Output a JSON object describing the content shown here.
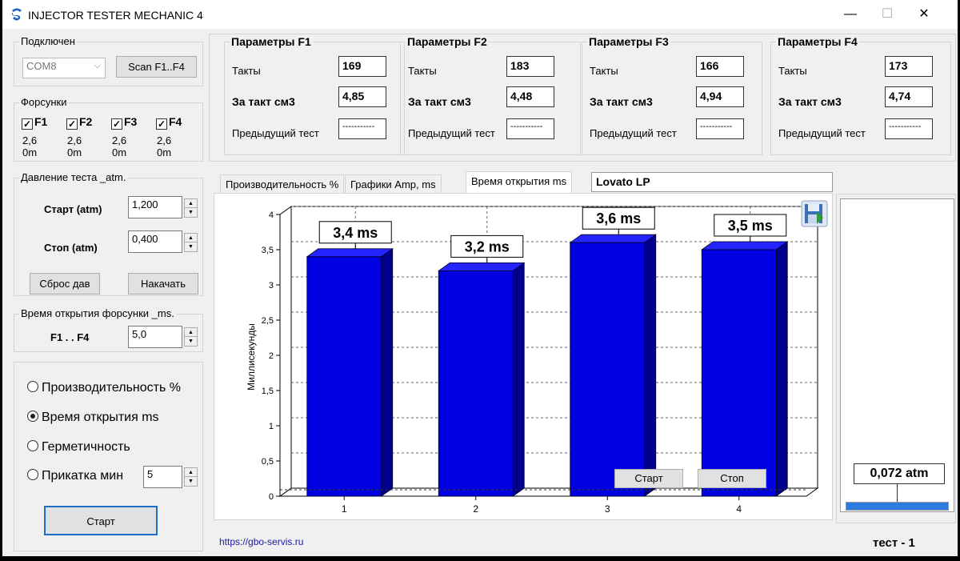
{
  "window": {
    "title": "INJECTOR TESTER MECHANIC 4",
    "controls": [
      "—",
      "☐",
      "✕"
    ]
  },
  "connection": {
    "title": "Подключен",
    "port": "COM8",
    "scan_label": "Scan F1..F4"
  },
  "injectors": {
    "title": "Форсунки",
    "items": [
      {
        "label": "F1",
        "checked": true,
        "line1": "2,6",
        "line2": "0m"
      },
      {
        "label": "F2",
        "checked": true,
        "line1": "2,6",
        "line2": "0m"
      },
      {
        "label": "F3",
        "checked": true,
        "line1": "2,6",
        "line2": "0m"
      },
      {
        "label": "F4",
        "checked": true,
        "line1": "2,6",
        "line2": "0m"
      }
    ]
  },
  "pressure": {
    "title": "Давление теста _atm.",
    "start_label": "Старт (atm)",
    "start_value": "1,200",
    "stop_label": "Стоп (atm)",
    "stop_value": "0,400",
    "reset_label": "Сброс дав",
    "pump_label": "Накачать"
  },
  "open_time": {
    "title": "Время открытия форсунки _ms.",
    "range_label": "F1 . . F4",
    "value": "5,0"
  },
  "modes": {
    "options": [
      {
        "label": "Производительность %",
        "selected": false
      },
      {
        "label": "Время открытия ms",
        "selected": true
      },
      {
        "label": "Герметичность",
        "selected": false
      },
      {
        "label": "Прикатка мин",
        "selected": false
      }
    ],
    "run_minutes": "5",
    "start_label": "Старт"
  },
  "params": [
    {
      "title": "Параметры F1",
      "cycles_label": "Такты",
      "cycles": "169",
      "per_cycle_label": "За такт см3",
      "per_cycle": "4,85",
      "prev_label": "Предыдущий тест",
      "prev": "-----------"
    },
    {
      "title": "Параметры F2",
      "cycles_label": "Такты",
      "cycles": "183",
      "per_cycle_label": "За такт см3",
      "per_cycle": "4,48",
      "prev_label": "Предыдущий тест",
      "prev": "-----------"
    },
    {
      "title": "Параметры F3",
      "cycles_label": "Такты",
      "cycles": "166",
      "per_cycle_label": "За такт см3",
      "per_cycle": "4,94",
      "prev_label": "Предыдущий тест",
      "prev": "-----------"
    },
    {
      "title": "Параметры F4",
      "cycles_label": "Такты",
      "cycles": "173",
      "per_cycle_label": "За такт см3",
      "per_cycle": "4,74",
      "prev_label": "Предыдущий тест",
      "prev": "-----------"
    }
  ],
  "tabs": [
    {
      "label": "Производительность %",
      "active": false
    },
    {
      "label": "Графики  Amp, ms",
      "active": false
    },
    {
      "label": "Время открытия ms",
      "active": true
    }
  ],
  "injector_model": "Lovato LP",
  "chart_buttons": {
    "start": "Старт",
    "stop": "Стоп"
  },
  "chart_data": {
    "type": "bar",
    "categories": [
      "1",
      "2",
      "3",
      "4"
    ],
    "values": [
      3.4,
      3.2,
      3.6,
      3.5
    ],
    "value_labels": [
      "3,4 ms",
      "3,2 ms",
      "3,6 ms",
      "3,5 ms"
    ],
    "ylabel": "Миллисекунды",
    "ylim": [
      0,
      4
    ],
    "yticks": [
      "0",
      "0,5",
      "1",
      "1,5",
      "2",
      "2,5",
      "3",
      "3,5",
      "4"
    ],
    "bar_color": "#0000e0",
    "grid": true
  },
  "pressure_gauge": {
    "value_label": "0,072 atm",
    "fill_fraction": 1.0
  },
  "footer": {
    "link": "https://gbo-servis.ru",
    "test_label": "тест - 1"
  }
}
